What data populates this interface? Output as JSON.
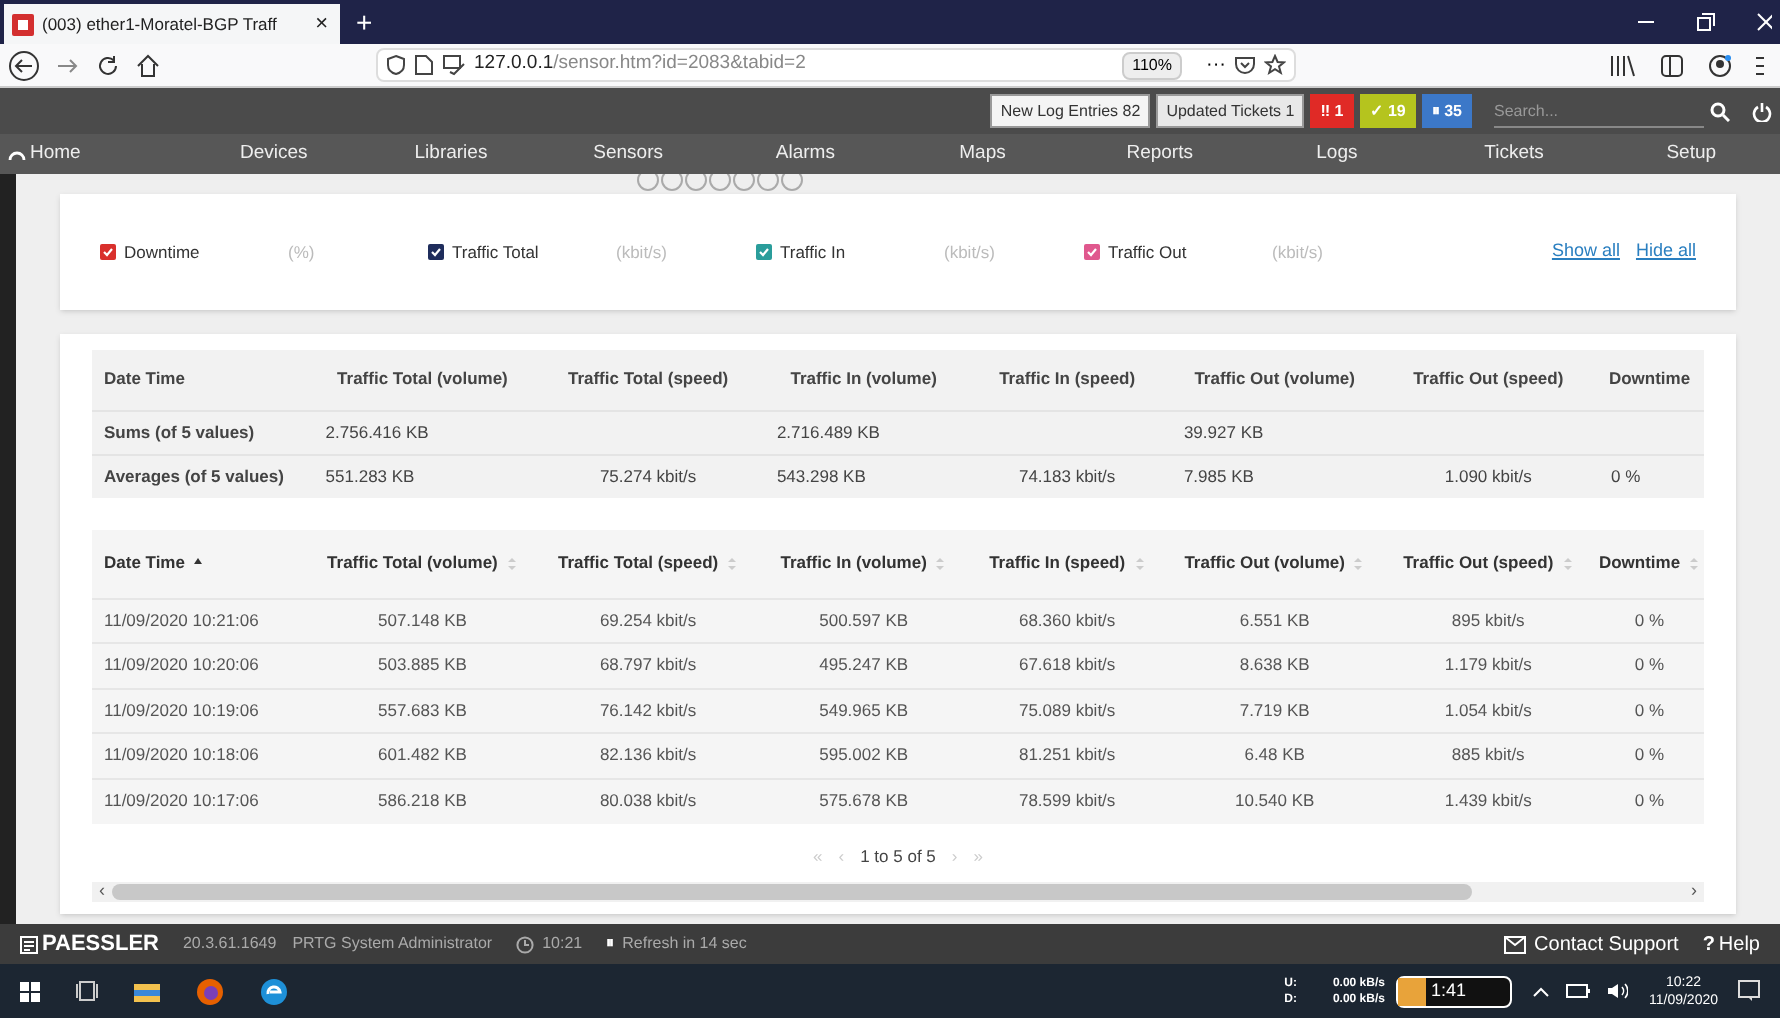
{
  "browser": {
    "tab_title": "(003) ether1-Moratel-BGP Traff",
    "tab_close": "×",
    "new_tab": "+",
    "url_host": "127.0.0.1",
    "url_path": "/sensor.htm?id=2083&tabid=2",
    "zoom": "110%",
    "more": "···"
  },
  "top_bar": {
    "buttons": [
      {
        "label": "New Log Entries",
        "count": "82",
        "kind": "plain"
      },
      {
        "label": "Updated Tickets",
        "count": "1",
        "kind": "light"
      }
    ],
    "status_badges": [
      {
        "icon": "‼",
        "count": "1",
        "color": "#e02a26"
      },
      {
        "icon": "✓",
        "count": "19",
        "color": "#b5c41e"
      },
      {
        "icon": "⏸",
        "count": "35",
        "color": "#3c78c8"
      }
    ],
    "search": {
      "placeholder": "Search..."
    }
  },
  "nav": [
    "Home",
    "Devices",
    "Libraries",
    "Sensors",
    "Alarms",
    "Maps",
    "Reports",
    "Logs",
    "Tickets",
    "Setup"
  ],
  "legend": {
    "channels": [
      {
        "name": "Downtime",
        "unit": "(%)",
        "checked": true,
        "color": "#d9302c"
      },
      {
        "name": "Traffic Total",
        "unit": "(kbit/s)",
        "checked": true,
        "color": "#1f2d5c"
      },
      {
        "name": "Traffic In",
        "unit": "(kbit/s)",
        "checked": true,
        "color": "#2a9d9b"
      },
      {
        "name": "Traffic Out",
        "unit": "(kbit/s)",
        "checked": true,
        "color": "#e0588e"
      }
    ],
    "links": [
      "Show all",
      "Hide all"
    ]
  },
  "summary": {
    "columns": [
      "Date Time",
      "Traffic Total (volume)",
      "Traffic Total (speed)",
      "Traffic In (volume)",
      "Traffic In (speed)",
      "Traffic Out (volume)",
      "Traffic Out (speed)",
      "Downtime"
    ],
    "rows": [
      [
        "Sums (of 5 values)",
        "2.756.416 KB",
        "",
        "2.716.489 KB",
        "",
        "39.927 KB",
        "",
        ""
      ],
      [
        "Averages (of 5 values)",
        "551.283 KB",
        "75.274 kbit/s",
        "543.298 KB",
        "74.183 kbit/s",
        "7.985 KB",
        "1.090 kbit/s",
        "0 %"
      ]
    ]
  },
  "table": {
    "columns": [
      {
        "label": "Date Time",
        "sorted": true
      },
      {
        "label": "Traffic Total (volume)",
        "sorted": false
      },
      {
        "label": "Traffic Total (speed)",
        "sorted": false
      },
      {
        "label": "Traffic In (volume)",
        "sorted": false
      },
      {
        "label": "Traffic In (speed)",
        "sorted": false
      },
      {
        "label": "Traffic Out (volume)",
        "sorted": false
      },
      {
        "label": "Traffic Out (speed)",
        "sorted": false
      },
      {
        "label": "Downtime",
        "sorted": false
      }
    ],
    "rows": [
      [
        "11/09/2020 10:21:06",
        "507.148 KB",
        "69.254 kbit/s",
        "500.597 KB",
        "68.360 kbit/s",
        "6.551 KB",
        "895 kbit/s",
        "0 %"
      ],
      [
        "11/09/2020 10:20:06",
        "503.885 KB",
        "68.797 kbit/s",
        "495.247 KB",
        "67.618 kbit/s",
        "8.638 KB",
        "1.179 kbit/s",
        "0 %"
      ],
      [
        "11/09/2020 10:19:06",
        "557.683 KB",
        "76.142 kbit/s",
        "549.965 KB",
        "75.089 kbit/s",
        "7.719 KB",
        "1.054 kbit/s",
        "0 %"
      ],
      [
        "11/09/2020 10:18:06",
        "601.482 KB",
        "82.136 kbit/s",
        "595.002 KB",
        "81.251 kbit/s",
        "6.48 KB",
        "885 kbit/s",
        "0 %"
      ],
      [
        "11/09/2020 10:17:06",
        "586.218 KB",
        "80.038 kbit/s",
        "575.678 KB",
        "78.599 kbit/s",
        "10.540 KB",
        "1.439 kbit/s",
        "0 %"
      ]
    ],
    "pager": {
      "first": "«",
      "prev": "‹",
      "info": "1 to 5 of 5",
      "next": "›",
      "last": "»"
    },
    "scroll_left": "‹",
    "scroll_right": "›"
  },
  "footer": {
    "logo": "PAESSLER",
    "version": "20.3.61.1649",
    "user": "PRTG System Administrator",
    "time": "10:21",
    "refresh_icon": "⏸",
    "refresh": "Refresh in 14 sec",
    "contact": "Contact Support",
    "help_icon": "?",
    "help": "Help"
  },
  "taskbar": {
    "net_labels": [
      "U:",
      "D:"
    ],
    "net_values": [
      "0.00 kB/s",
      "0.00 kB/s"
    ],
    "widget": "1:41",
    "time": "10:22",
    "date": "11/09/2020"
  }
}
